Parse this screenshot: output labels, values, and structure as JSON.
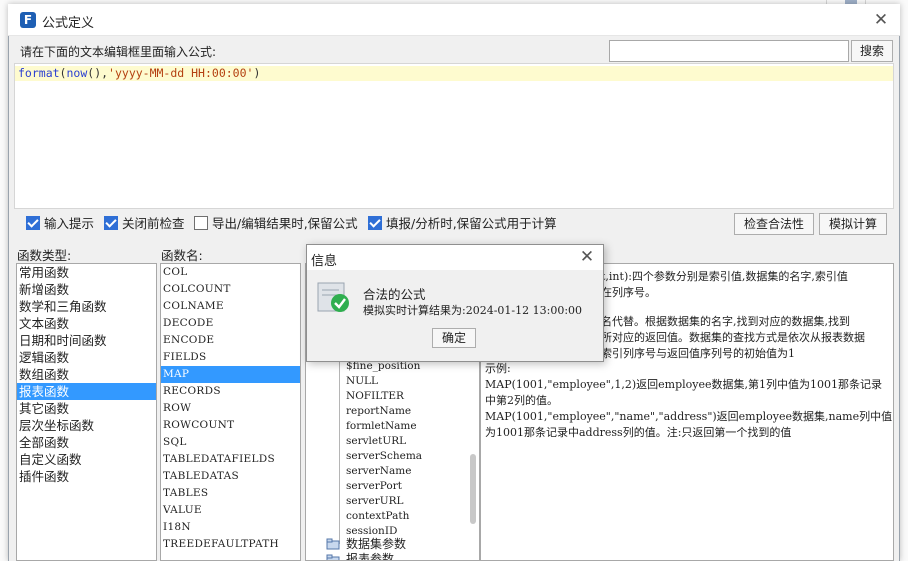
{
  "dialog": {
    "title": "公式定义",
    "close_icon": "close-icon"
  },
  "prompt_label": "请在下面的文本编辑框里面输入公式:",
  "search": {
    "value": "",
    "button_label": "搜索"
  },
  "formula": {
    "fn": "format",
    "inner_fn": "now",
    "arg": "'yyyy-MM-dd HH:00:00'"
  },
  "options": [
    {
      "label": "输入提示",
      "checked": true
    },
    {
      "label": "关闭前检查",
      "checked": true
    },
    {
      "label": "导出/编辑结果时,保留公式",
      "checked": false
    },
    {
      "label": "填报/分析时,保留公式用于计算",
      "checked": true
    }
  ],
  "buttons": {
    "check_validity": "检查合法性",
    "simulate": "模拟计算"
  },
  "func_types": {
    "header": "函数类型:",
    "items": [
      "常用函数",
      "新增函数",
      "数学和三角函数",
      "文本函数",
      "日期和时间函数",
      "逻辑函数",
      "数组函数",
      "报表函数",
      "其它函数",
      "层次坐标函数",
      "全部函数",
      "自定义函数",
      "插件函数"
    ],
    "selected": "报表函数"
  },
  "func_names": {
    "header": "函数名:",
    "items": [
      "COL",
      "COLCOUNT",
      "COLNAME",
      "DECODE",
      "ENCODE",
      "FIELDS",
      "MAP",
      "RECORDS",
      "ROW",
      "ROWCOUNT",
      "SQL",
      "TABLEDATAFIELDS",
      "TABLEDATAS",
      "TABLES",
      "VALUE",
      "I18N",
      "TREEDEFAULTPATH"
    ],
    "selected": "MAP"
  },
  "params_tree": {
    "items": [
      "$fine_position",
      "NULL",
      "NOFILTER",
      "reportName",
      "formletName",
      "servletURL",
      "serverSchema",
      "serverName",
      "serverPort",
      "serverURL",
      "contextPath",
      "sessionID"
    ],
    "groups": [
      "数据集参数",
      "报表参数"
    ]
  },
  "description": {
    "lines": [
      "t,int):四个参数分别是索引值,数据集的名字,索引值",
      "在列序号。",
      "名代替。根据数据集的名字,找到对应的数据集,找到",
      "所对应的返回值。数据集的查找方式是依次从报表数据",
      "索引列序号与返回值序列号的初始值为1",
      "示例:",
      "MAP(1001,\"employee\",1,2)返回employee数据集,第1列中值为1001那条记录",
      "中第2列的值。",
      "MAP(1001,\"employee\",\"name\",\"address\")返回employee数据集,name列中值",
      "为1001那条记录中address列的值。注:只返回第一个找到的值"
    ]
  },
  "info_dialog": {
    "title": "信息",
    "message": "合法的公式",
    "result": "模拟实时计算结果为:2024-01-12 13:00:00",
    "ok_label": "确定"
  }
}
